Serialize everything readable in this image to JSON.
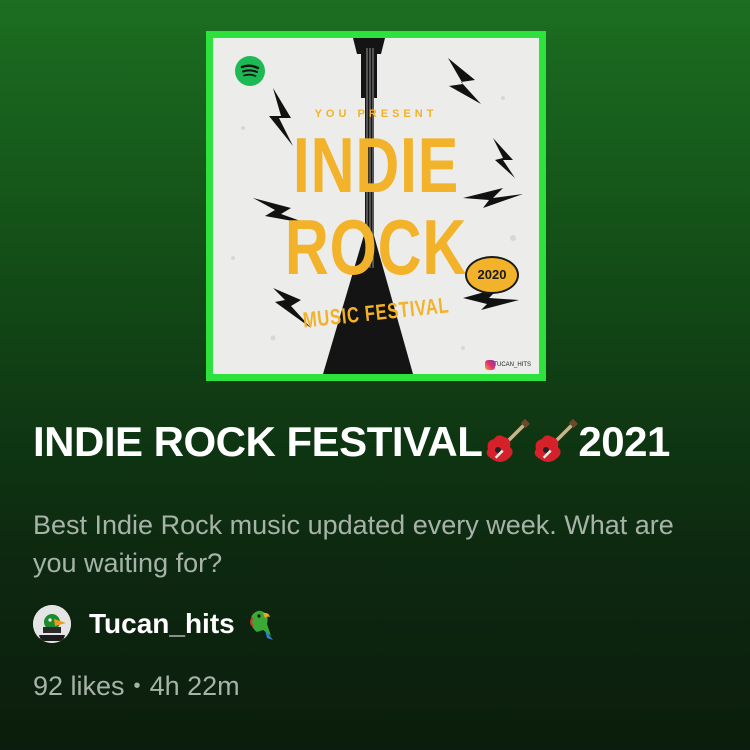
{
  "cover": {
    "presenter_text": "YOU PRESENT",
    "line1": "INDIE",
    "line2": "ROCK",
    "subtitle": "MUSIC FESTIVAL",
    "year_badge": "2020",
    "handle": "TUCAN_HITS",
    "border_color": "#2ee23e",
    "accent_color": "#f2b22a",
    "logo_icon": "spotify-icon",
    "social_icon": "instagram-icon"
  },
  "playlist": {
    "title_prefix": "INDIE ROCK FESTIVAL",
    "title_suffix": "2021",
    "title_icons": [
      "guitar-icon",
      "guitar-icon"
    ],
    "description": "Best Indie Rock music updated every week. What are you waiting for?"
  },
  "owner": {
    "name": "Tucan_hits",
    "avatar_icon": "toucan-avatar",
    "name_icon": "parrot-icon"
  },
  "meta": {
    "likes": "92 likes",
    "separator": "•",
    "duration": "4h 22m"
  },
  "colors": {
    "background_top": "#1c6e22",
    "background_bottom": "#0b1d0c",
    "text_primary": "#ffffff",
    "text_secondary": "#a7b3a8"
  }
}
